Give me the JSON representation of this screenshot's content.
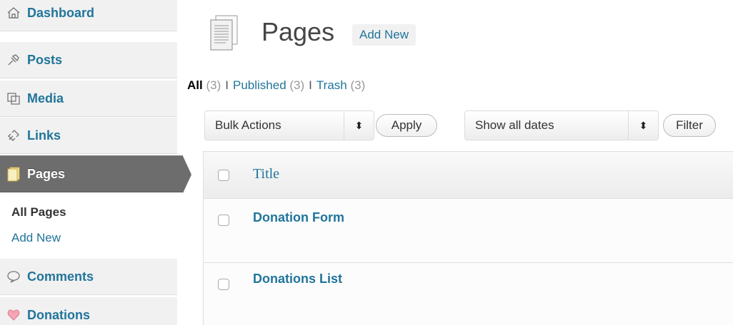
{
  "sidebar": {
    "items": [
      {
        "label": "Dashboard",
        "icon": "home-icon"
      },
      {
        "label": "Posts",
        "icon": "pin-icon"
      },
      {
        "label": "Media",
        "icon": "media-icon"
      },
      {
        "label": "Links",
        "icon": "link-icon"
      },
      {
        "label": "Pages",
        "icon": "pages-icon"
      },
      {
        "label": "Comments",
        "icon": "comment-icon"
      },
      {
        "label": "Donations",
        "icon": "heart-icon"
      }
    ],
    "submenu": {
      "current": "All Pages",
      "add_new": "Add New"
    }
  },
  "header": {
    "title": "Pages",
    "add_new": "Add New"
  },
  "filters": {
    "all_label": "All",
    "all_count": "(3)",
    "published_label": "Published",
    "published_count": "(3)",
    "trash_label": "Trash",
    "trash_count": "(3)",
    "separator": "I"
  },
  "toolbar": {
    "bulk_actions": "Bulk Actions",
    "apply": "Apply",
    "dates": "Show all dates",
    "filter": "Filter",
    "arrows_glyph": "⬍"
  },
  "table": {
    "column_title": "Title",
    "rows": [
      {
        "title": "Donation Form"
      },
      {
        "title": "Donations List"
      }
    ]
  },
  "colors": {
    "link": "#21759b",
    "current_menu": "#6d6d6d"
  }
}
